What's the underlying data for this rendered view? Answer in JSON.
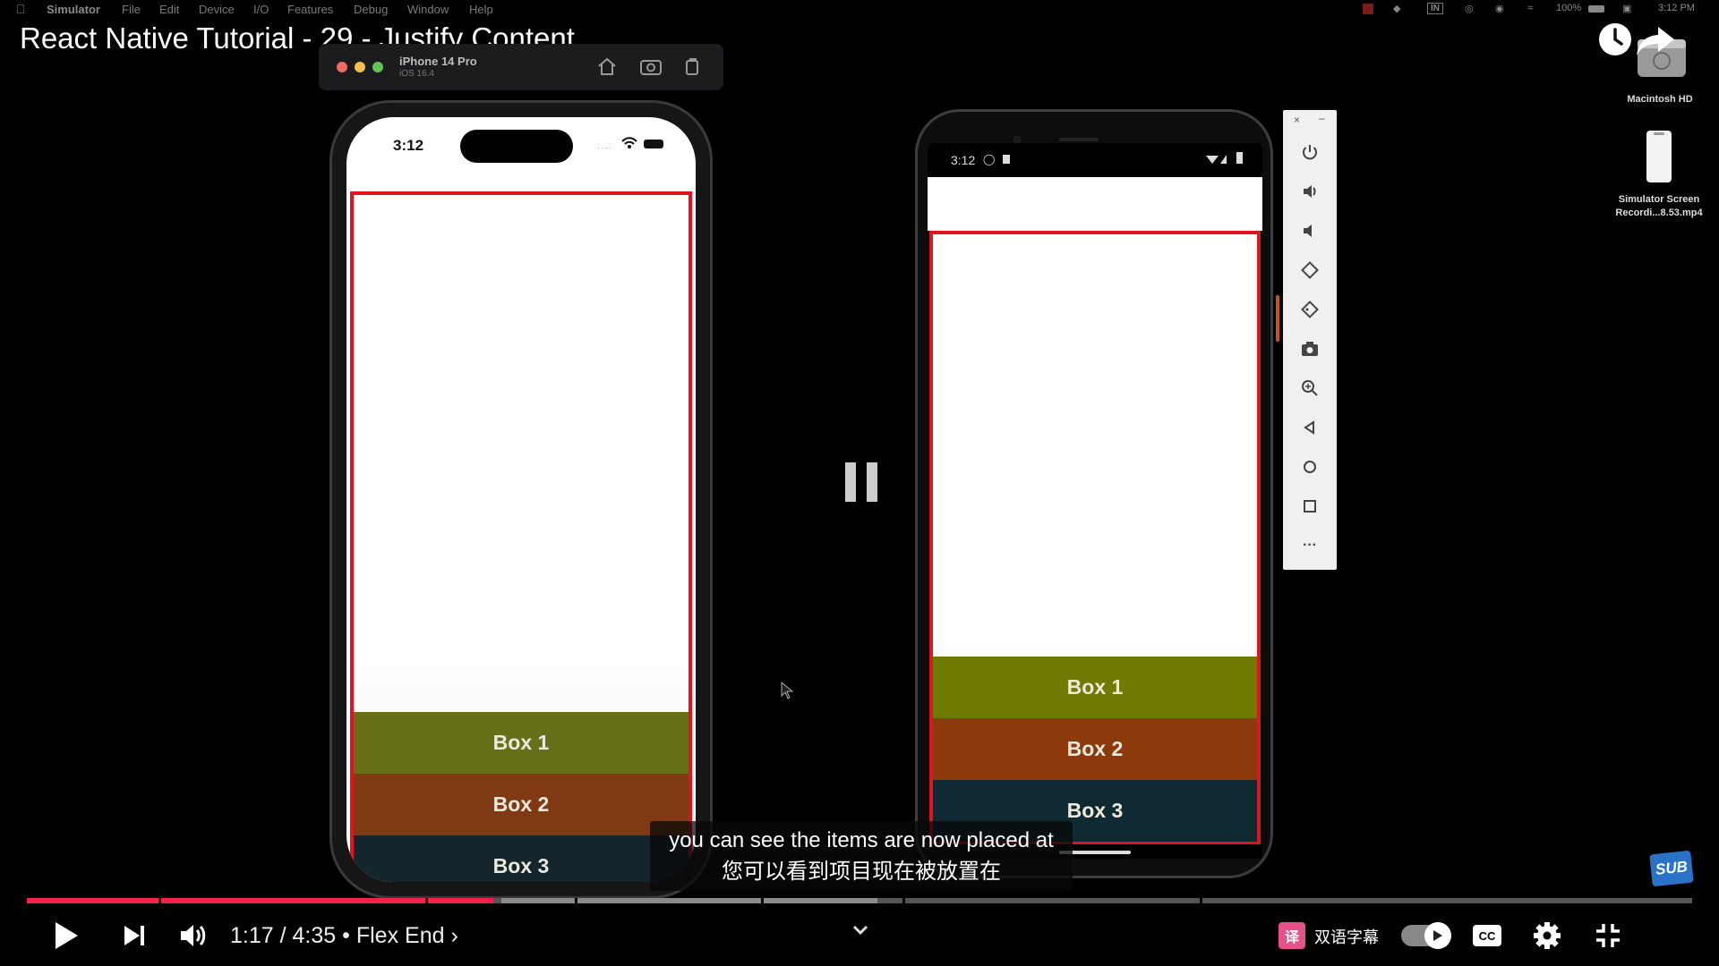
{
  "menubar": {
    "app": "Simulator",
    "items": [
      "File",
      "Edit",
      "Device",
      "I/O",
      "Features",
      "Debug",
      "Window",
      "Help"
    ],
    "battery": "100%",
    "clock": "3:12 PM"
  },
  "video": {
    "title": "React Native Tutorial - 29 - Justify Content"
  },
  "desktop": {
    "items": [
      {
        "label": "Macintosh HD"
      },
      {
        "label_line1": "Simulator Screen",
        "label_line2": "Recordi...8.53.mp4"
      }
    ]
  },
  "simulator": {
    "device": "iPhone 14 Pro",
    "os": "iOS 16.4"
  },
  "iphone": {
    "time": "3:12"
  },
  "android": {
    "time": "3:12"
  },
  "boxes": [
    {
      "label": "Box 1",
      "color": "#677018"
    },
    {
      "label": "Box 2",
      "color": "#7f3a13"
    },
    {
      "label": "Box 3",
      "color": "#14262c"
    }
  ],
  "android_boxes": [
    {
      "label": "Box 1",
      "color": "#6e7b00"
    },
    {
      "label": "Box 2",
      "color": "#8c3a0c"
    },
    {
      "label": "Box 3",
      "color": "#0f2a33"
    }
  ],
  "captions": {
    "line1": "you can see the items are now placed at",
    "line2": "您可以看到项目现在被放置在"
  },
  "player": {
    "current_time": "1:17",
    "duration": "4:35",
    "chapter": "Flex End",
    "played_fraction": 0.28,
    "subtitle_toggle_label": "双语字幕",
    "sub_badge": "SUB",
    "accent_color": "#f1234a"
  }
}
